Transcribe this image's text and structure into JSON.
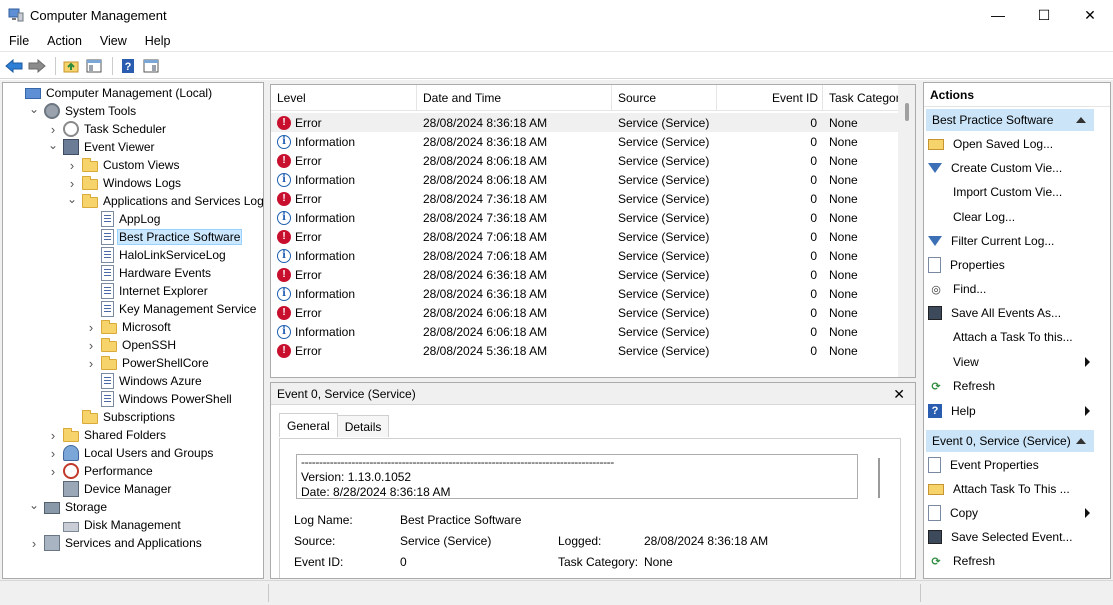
{
  "window": {
    "title": "Computer Management",
    "icon": "computer-management-icon",
    "controls": {
      "minimize": "—",
      "maximize": "☐",
      "close": "✕"
    }
  },
  "menu": [
    "File",
    "Action",
    "View",
    "Help"
  ],
  "toolbar": [
    "back-arrow-icon",
    "forward-arrow-icon",
    "up-folder-icon",
    "show-hide-tree-icon",
    "help-icon",
    "show-hide-action-pane-icon"
  ],
  "tree": [
    {
      "label": "Computer Management (Local)",
      "depth": 0,
      "expander": "",
      "icon": "comp",
      "selected": false
    },
    {
      "label": "System Tools",
      "depth": 1,
      "expander": "open",
      "icon": "gear",
      "selected": false
    },
    {
      "label": "Task Scheduler",
      "depth": 2,
      "expander": "closed",
      "icon": "clock",
      "selected": false
    },
    {
      "label": "Event Viewer",
      "depth": 2,
      "expander": "open",
      "icon": "evv",
      "selected": false
    },
    {
      "label": "Custom Views",
      "depth": 3,
      "expander": "closed",
      "icon": "folder",
      "selected": false
    },
    {
      "label": "Windows Logs",
      "depth": 3,
      "expander": "closed",
      "icon": "folder",
      "selected": false
    },
    {
      "label": "Applications and Services Logs",
      "depth": 3,
      "expander": "open",
      "icon": "folder",
      "selected": false
    },
    {
      "label": "AppLog",
      "depth": 4,
      "expander": "",
      "icon": "logfile",
      "selected": false
    },
    {
      "label": "Best Practice Software",
      "depth": 4,
      "expander": "",
      "icon": "logfile",
      "selected": true
    },
    {
      "label": "HaloLinkServiceLog",
      "depth": 4,
      "expander": "",
      "icon": "logfile",
      "selected": false
    },
    {
      "label": "Hardware Events",
      "depth": 4,
      "expander": "",
      "icon": "logfile",
      "selected": false
    },
    {
      "label": "Internet Explorer",
      "depth": 4,
      "expander": "",
      "icon": "logfile",
      "selected": false
    },
    {
      "label": "Key Management Service",
      "depth": 4,
      "expander": "",
      "icon": "logfile",
      "selected": false
    },
    {
      "label": "Microsoft",
      "depth": 4,
      "expander": "closed",
      "icon": "folder",
      "selected": false
    },
    {
      "label": "OpenSSH",
      "depth": 4,
      "expander": "closed",
      "icon": "folder",
      "selected": false
    },
    {
      "label": "PowerShellCore",
      "depth": 4,
      "expander": "closed",
      "icon": "folder",
      "selected": false
    },
    {
      "label": "Windows Azure",
      "depth": 4,
      "expander": "",
      "icon": "logfile",
      "selected": false
    },
    {
      "label": "Windows PowerShell",
      "depth": 4,
      "expander": "",
      "icon": "logfile",
      "selected": false
    },
    {
      "label": "Subscriptions",
      "depth": 3,
      "expander": "",
      "icon": "folder",
      "selected": false
    },
    {
      "label": "Shared Folders",
      "depth": 2,
      "expander": "closed",
      "icon": "folder",
      "selected": false
    },
    {
      "label": "Local Users and Groups",
      "depth": 2,
      "expander": "closed",
      "icon": "users",
      "selected": false
    },
    {
      "label": "Performance",
      "depth": 2,
      "expander": "closed",
      "icon": "perf",
      "selected": false
    },
    {
      "label": "Device Manager",
      "depth": 2,
      "expander": "",
      "icon": "devmgr",
      "selected": false
    },
    {
      "label": "Storage",
      "depth": 1,
      "expander": "open",
      "icon": "storage",
      "selected": false
    },
    {
      "label": "Disk Management",
      "depth": 2,
      "expander": "",
      "icon": "disk",
      "selected": false
    },
    {
      "label": "Services and Applications",
      "depth": 1,
      "expander": "closed",
      "icon": "svc",
      "selected": false
    }
  ],
  "events": {
    "columns": [
      "Level",
      "Date and Time",
      "Source",
      "Event ID",
      "Task Category"
    ],
    "rows": [
      {
        "level": "Error",
        "datetime": "28/08/2024 8:36:18 AM",
        "source": "Service (Service)",
        "event_id": "0",
        "task_category": "None"
      },
      {
        "level": "Information",
        "datetime": "28/08/2024 8:36:18 AM",
        "source": "Service (Service)",
        "event_id": "0",
        "task_category": "None"
      },
      {
        "level": "Error",
        "datetime": "28/08/2024 8:06:18 AM",
        "source": "Service (Service)",
        "event_id": "0",
        "task_category": "None"
      },
      {
        "level": "Information",
        "datetime": "28/08/2024 8:06:18 AM",
        "source": "Service (Service)",
        "event_id": "0",
        "task_category": "None"
      },
      {
        "level": "Error",
        "datetime": "28/08/2024 7:36:18 AM",
        "source": "Service (Service)",
        "event_id": "0",
        "task_category": "None"
      },
      {
        "level": "Information",
        "datetime": "28/08/2024 7:36:18 AM",
        "source": "Service (Service)",
        "event_id": "0",
        "task_category": "None"
      },
      {
        "level": "Error",
        "datetime": "28/08/2024 7:06:18 AM",
        "source": "Service (Service)",
        "event_id": "0",
        "task_category": "None"
      },
      {
        "level": "Information",
        "datetime": "28/08/2024 7:06:18 AM",
        "source": "Service (Service)",
        "event_id": "0",
        "task_category": "None"
      },
      {
        "level": "Error",
        "datetime": "28/08/2024 6:36:18 AM",
        "source": "Service (Service)",
        "event_id": "0",
        "task_category": "None"
      },
      {
        "level": "Information",
        "datetime": "28/08/2024 6:36:18 AM",
        "source": "Service (Service)",
        "event_id": "0",
        "task_category": "None"
      },
      {
        "level": "Error",
        "datetime": "28/08/2024 6:06:18 AM",
        "source": "Service (Service)",
        "event_id": "0",
        "task_category": "None"
      },
      {
        "level": "Information",
        "datetime": "28/08/2024 6:06:18 AM",
        "source": "Service (Service)",
        "event_id": "0",
        "task_category": "None"
      },
      {
        "level": "Error",
        "datetime": "28/08/2024 5:36:18 AM",
        "source": "Service (Service)",
        "event_id": "0",
        "task_category": "None"
      }
    ]
  },
  "detail": {
    "title": "Event 0, Service (Service)",
    "close": "✕",
    "tabs": [
      "General",
      "Details"
    ],
    "message_lines": [
      "---------------------------------------------------------------------------------------",
      "Version:  1.13.0.1052",
      "Date: 8/28/2024 8:36:18 AM"
    ],
    "fields": {
      "log_name_label": "Log Name:",
      "log_name": "Best Practice Software",
      "source_label": "Source:",
      "source": "Service (Service)",
      "logged_label": "Logged:",
      "logged": "28/08/2024 8:36:18 AM",
      "event_id_label": "Event ID:",
      "event_id": "0",
      "task_category_label": "Task Category:",
      "task_category": "None"
    }
  },
  "actions": {
    "title": "Actions",
    "sections": [
      {
        "label": "Best Practice Software",
        "items": [
          {
            "label": "Open Saved Log...",
            "icon": "a-open",
            "submenu": false
          },
          {
            "label": "Create Custom Vie...",
            "icon": "a-filter",
            "submenu": false
          },
          {
            "label": "Import Custom Vie...",
            "icon": "",
            "submenu": false
          },
          {
            "label": "Clear Log...",
            "icon": "",
            "submenu": false
          },
          {
            "label": "Filter Current Log...",
            "icon": "a-filter",
            "submenu": false
          },
          {
            "label": "Properties",
            "icon": "a-doc",
            "submenu": false
          },
          {
            "label": "Find...",
            "icon": "a-find",
            "submenu": false
          },
          {
            "label": "Save All Events As...",
            "icon": "a-save",
            "submenu": false
          },
          {
            "label": "Attach a Task To this...",
            "icon": "",
            "submenu": false
          },
          {
            "label": "View",
            "icon": "",
            "submenu": true
          },
          {
            "label": "Refresh",
            "icon": "a-refresh",
            "submenu": false
          },
          {
            "label": "Help",
            "icon": "a-help",
            "submenu": true
          }
        ]
      },
      {
        "label": "Event 0, Service (Service)",
        "items": [
          {
            "label": "Event Properties",
            "icon": "a-doc",
            "submenu": false
          },
          {
            "label": "Attach Task To This ...",
            "icon": "a-open",
            "submenu": false
          },
          {
            "label": "Copy",
            "icon": "a-doc",
            "submenu": true
          },
          {
            "label": "Save Selected Event...",
            "icon": "a-save",
            "submenu": false
          },
          {
            "label": "Refresh",
            "icon": "a-refresh",
            "submenu": false
          }
        ]
      }
    ]
  }
}
